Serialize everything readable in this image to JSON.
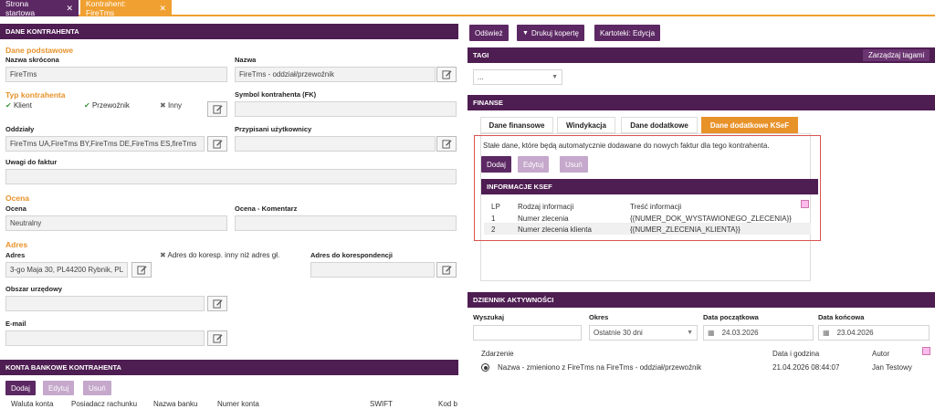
{
  "tabs": [
    {
      "label": "Strona startowa"
    },
    {
      "label": "Kontrahent: FireTms"
    }
  ],
  "left": {
    "header": "DANE KONTRAHENTA",
    "basic_title": "Dane podstawowe",
    "short_name_label": "Nazwa skrócona",
    "short_name_value": "FireTms",
    "name_label": "Nazwa",
    "name_value": "FireTms - oddział/przewoźnik",
    "type_title": "Typ kontrahenta",
    "type_client": "Klient",
    "type_carrier": "Przewoźnik",
    "type_other": "Inny",
    "symbol_label": "Symbol kontrahenta (FK)",
    "symbol_value": "",
    "branches_label": "Oddziały",
    "branches_value": "FireTms UA,FireTms BY,FireTms DE,FireTms ES,fireTms",
    "assigned_label": "Przypisani użytkownicy",
    "notes_label": "Uwagi do faktur",
    "rating_title": "Ocena",
    "rating_label": "Ocena",
    "rating_value": "Neutralny",
    "rating_comment_label": "Ocena - Komentarz",
    "address_title": "Adres",
    "address_label": "Adres",
    "address_other_note": "Adres do koresp. inny niż adres gł.",
    "correspondence_label": "Adres do korespondencji",
    "address_value": "3-go Maja 30, PL44200 Rybnik, PL",
    "office_label": "Obszar urzędowy",
    "email_label": "E-mail"
  },
  "bank": {
    "header": "KONTA BANKOWE KONTRAHENTA",
    "add": "Dodaj",
    "edit": "Edytuj",
    "delete": "Usuń",
    "columns": [
      "Waluta konta",
      "Posiadacz rachunku",
      "Nazwa banku",
      "Numer konta",
      "SWIFT",
      "Kod b"
    ]
  },
  "toolbar": {
    "refresh": "Odśwież",
    "print": "Drukuj kopertę",
    "cards": "Kartoteki: Edycja"
  },
  "tags": {
    "header": "TAGI",
    "manage": "Zarządzaj tagami",
    "select_value": "..."
  },
  "finance": {
    "header": "FINANSE",
    "tabs": [
      "Dane finansowe",
      "Windykacja",
      "Dane dodatkowe",
      "Dane dodatkowe KSeF"
    ],
    "desc": "Stałe dane, które będą automatycznie dodawane do nowych faktur dla tego kontrahenta.",
    "add": "Dodaj",
    "edit": "Edytuj",
    "delete": "Usuń",
    "ksef_header": "INFORMACJE KSEF",
    "columns": [
      "LP",
      "Rodzaj informacji",
      "Treść informacji"
    ],
    "rows": [
      {
        "lp": "1",
        "type": "Numer zlecenia",
        "content": "{{NUMER_DOK_WYSTAWIONEGO_ZLECENIA}}"
      },
      {
        "lp": "2",
        "type": "Numer zlecenia klienta",
        "content": "{{NUMER_ZLECENIA_KLIENTA}}"
      }
    ]
  },
  "activity": {
    "header": "DZIENNIK AKTYWNOŚCI",
    "search_label": "Wyszukaj",
    "period_label": "Okres",
    "period_value": "Ostatnie 30 dni",
    "start_label": "Data początkowa",
    "start_value": "24.03.2026",
    "end_label": "Data końcowa",
    "end_value": "23.04.2026",
    "columns": [
      "Zdarzenie",
      "Data i godzina",
      "Autor"
    ],
    "rows": [
      {
        "event": "Nazwa - zmieniono z FireTms na FireTms - oddział/przewoźnik",
        "datetime": "21.04.2026 08:44:07",
        "author": "Jan Testowy"
      }
    ]
  },
  "colors": {
    "header": "#4e1d52",
    "accent": "#e8922a",
    "button": "#5c2863",
    "highlight": "#d9534f"
  }
}
